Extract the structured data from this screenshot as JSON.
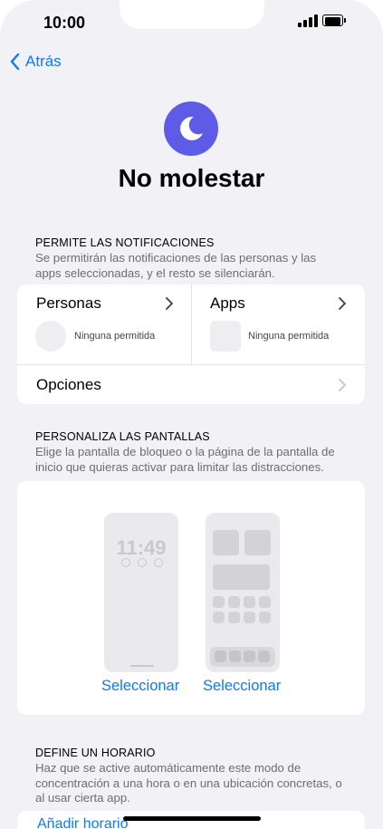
{
  "status_bar": {
    "time": "10:00"
  },
  "nav": {
    "back_label": "Atrás"
  },
  "page": {
    "title": "No molestar"
  },
  "notifications": {
    "header": "PERMITE LAS NOTIFICACIONES",
    "description": "Se permitirán las notificaciones de las personas y las apps seleccionadas, y el resto se silenciarán.",
    "people": {
      "label": "Personas",
      "status": "Ninguna permitida"
    },
    "apps": {
      "label": "Apps",
      "status": "Ninguna permitida"
    },
    "options_label": "Opciones"
  },
  "screens": {
    "header": "PERSONALIZA LAS PANTALLAS",
    "description": "Elige la pantalla de bloqueo o la página de la pantalla de inicio que quieras activar para limitar las distracciones.",
    "lock_time": "11:49",
    "select_lock": "Seleccionar",
    "select_home": "Seleccionar"
  },
  "schedule": {
    "header": "DEFINE UN HORARIO",
    "description": "Haz que se active automáticamente este modo de concentración a una hora o en una ubicación concretas, o al usar cierta app.",
    "add_label": "Añadir horario"
  },
  "colors": {
    "accent": "#0a7aff",
    "focus_purple": "#5e5ce6",
    "background": "#f1f1f6"
  }
}
